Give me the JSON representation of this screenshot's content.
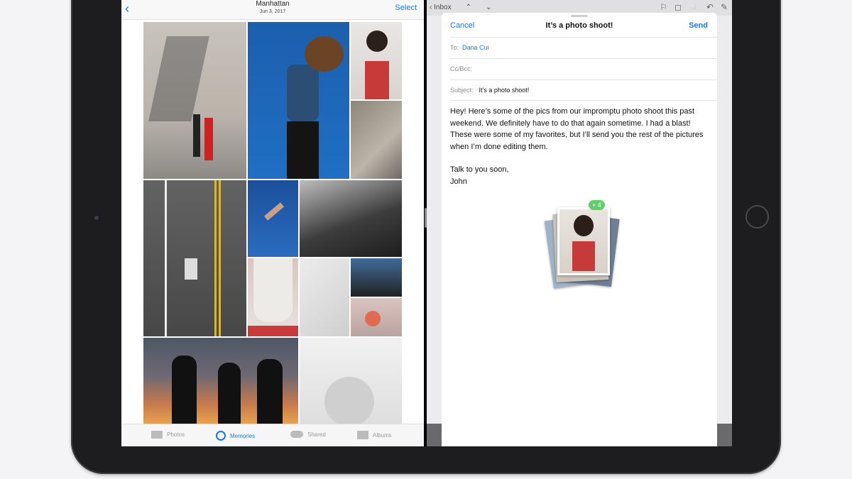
{
  "photos": {
    "back_icon": "chevron-left-icon",
    "title": "Manhattan",
    "date": "Jun 3, 2017",
    "select_label": "Select",
    "tabs": [
      {
        "label": "Photos",
        "icon": "photos-icon"
      },
      {
        "label": "Memories",
        "icon": "memories-icon",
        "active": true
      },
      {
        "label": "Shared",
        "icon": "cloud-icon"
      },
      {
        "label": "Albums",
        "icon": "albums-icon"
      }
    ],
    "accent": "#1479f0"
  },
  "mail": {
    "inbox_label": "Inbox",
    "toolbar_icons": [
      "flag-icon",
      "folder-icon",
      "trash-icon",
      "reply-icon",
      "compose-icon"
    ]
  },
  "compose": {
    "cancel_label": "Cancel",
    "title": "It’s a photo shoot!",
    "send_label": "Send",
    "to_label": "To:",
    "to_value": "Dana Cui",
    "ccbcc_label": "Cc/Bcc:",
    "subject_label": "Subject:",
    "subject_value": "It’s a photo shoot!",
    "body": [
      "Hey! Here’s some of the pics from our impromptu photo shoot this past weekend. We definitely have to do that again sometime. I had a blast! These were some of my favorites, but I’ll send you the rest of the pictures when I’m done editing them.",
      "Talk to you soon,",
      "John"
    ],
    "attachment_badge": "+ 4",
    "badge_color": "#5fcf6a"
  }
}
